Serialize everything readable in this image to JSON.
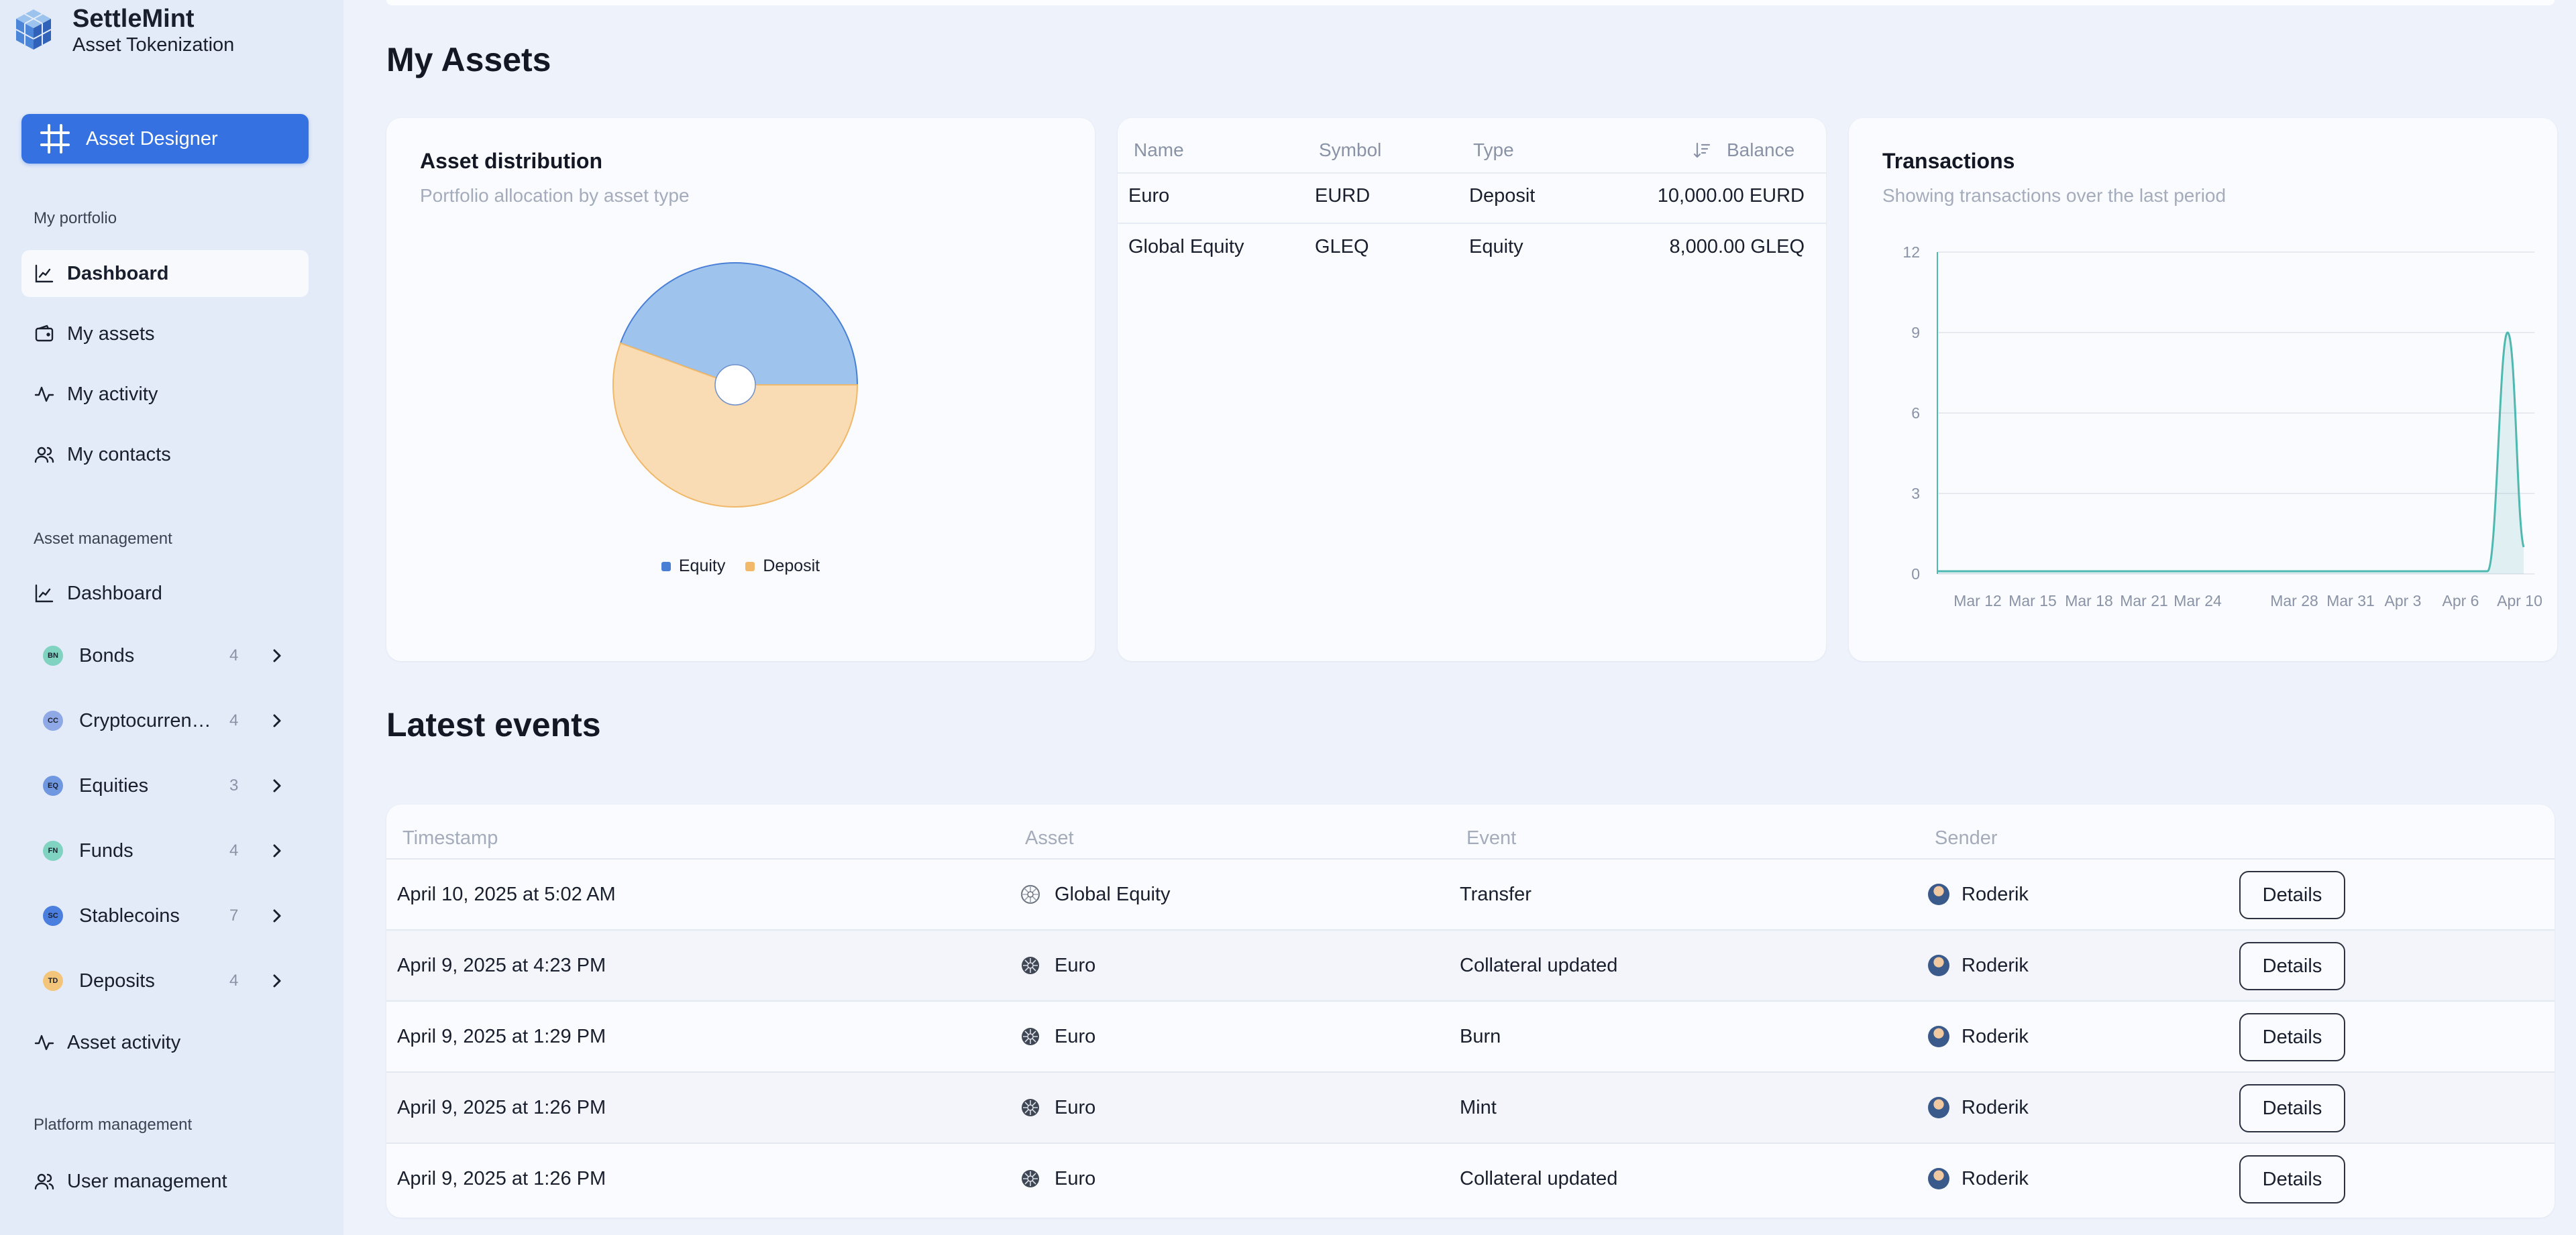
{
  "brand": {
    "title": "SettleMint",
    "subtitle": "Asset Tokenization"
  },
  "sidebar": {
    "designer_label": "Asset Designer",
    "portfolio_label": "My portfolio",
    "portfolio_items": [
      "Dashboard",
      "My assets",
      "My activity",
      "My contacts"
    ],
    "asset_mgmt_label": "Asset management",
    "asset_dashboard": "Dashboard",
    "asset_types": [
      {
        "badge": "BN",
        "name": "Bonds",
        "count": "4",
        "color": "#7fd3c0"
      },
      {
        "badge": "CC",
        "name": "Cryptocurrencies",
        "count": "4",
        "color": "#8fa9e6"
      },
      {
        "badge": "EQ",
        "name": "Equities",
        "count": "3",
        "color": "#6f98e0"
      },
      {
        "badge": "FN",
        "name": "Funds",
        "count": "4",
        "color": "#7fd3c0"
      },
      {
        "badge": "SC",
        "name": "Stablecoins",
        "count": "7",
        "color": "#4a7fe0"
      },
      {
        "badge": "TD",
        "name": "Deposits",
        "count": "4",
        "color": "#f3c57a"
      }
    ],
    "asset_activity": "Asset activity",
    "platform_label": "Platform management",
    "user_mgmt": "User management"
  },
  "my_assets": {
    "heading": "My Assets",
    "distribution": {
      "title": "Asset distribution",
      "subtitle": "Portfolio allocation by asset type",
      "legend": [
        "Equity",
        "Deposit"
      ]
    },
    "table": {
      "headers": [
        "Name",
        "Symbol",
        "Type",
        "Balance"
      ],
      "rows": [
        [
          "Euro",
          "EURD",
          "Deposit",
          "10,000.00 EURD"
        ],
        [
          "Global Equity",
          "GLEQ",
          "Equity",
          "8,000.00 GLEQ"
        ]
      ]
    },
    "transactions": {
      "title": "Transactions",
      "subtitle": "Showing transactions over the last period"
    }
  },
  "chart_data": [
    {
      "type": "pie",
      "labels": [
        "Equity",
        "Deposit"
      ],
      "values": [
        8000,
        10000
      ],
      "colors": [
        "#9ec4ee",
        "#f9dcb4"
      ],
      "legend": "bottom"
    },
    {
      "type": "area",
      "x": [
        "Mar 12",
        "Mar 15",
        "Mar 18",
        "Mar 21",
        "Mar 24",
        "Mar 28",
        "Mar 31",
        "Apr 3",
        "Apr 6",
        "Apr 8",
        "Apr 9",
        "Apr 10"
      ],
      "y": [
        0,
        0,
        0,
        0,
        0,
        0,
        0,
        0,
        0,
        0,
        9,
        1
      ],
      "yticks": [
        "0",
        "3",
        "6",
        "9",
        "12"
      ],
      "xtick_labels": [
        "Mar 12",
        "Mar 15",
        "Mar 18",
        "Mar 21",
        "Mar 24",
        "Mar 28",
        "Mar 31",
        "Apr 3",
        "Apr 6",
        "Apr 10"
      ],
      "ylim": [
        0,
        12
      ],
      "grid": true,
      "color": "#4fb8b0"
    }
  ],
  "events": {
    "heading": "Latest events",
    "headers": [
      "Timestamp",
      "Asset",
      "Event",
      "Sender"
    ],
    "details_label": "Details",
    "rows": [
      {
        "timestamp": "April 10, 2025 at 5:02 AM",
        "asset": "Global Equity",
        "event": "Transfer",
        "sender": "Roderik"
      },
      {
        "timestamp": "April 9, 2025 at 4:23 PM",
        "asset": "Euro",
        "event": "Collateral updated",
        "sender": "Roderik"
      },
      {
        "timestamp": "April 9, 2025 at 1:29 PM",
        "asset": "Euro",
        "event": "Burn",
        "sender": "Roderik"
      },
      {
        "timestamp": "April 9, 2025 at 1:26 PM",
        "asset": "Euro",
        "event": "Mint",
        "sender": "Roderik"
      },
      {
        "timestamp": "April 9, 2025 at 1:26 PM",
        "asset": "Euro",
        "event": "Collateral updated",
        "sender": "Roderik"
      }
    ]
  }
}
